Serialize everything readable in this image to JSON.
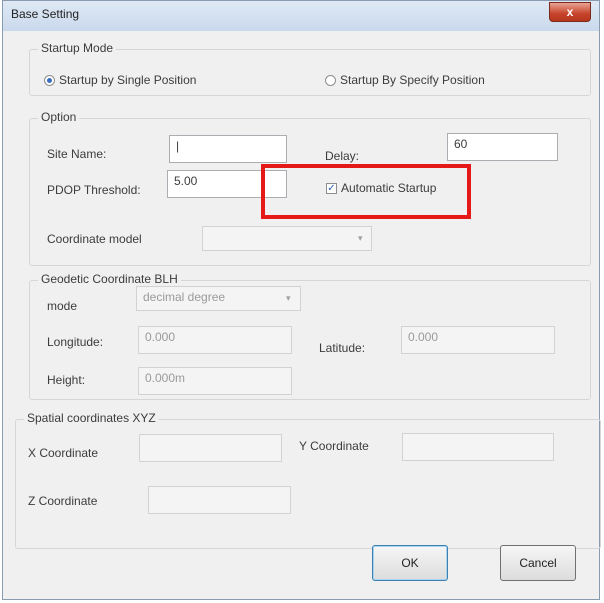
{
  "window": {
    "title": "Base Setting",
    "close_label": "x"
  },
  "startup_mode": {
    "legend": "Startup Mode",
    "option_single": "Startup by Single Position",
    "option_specify": "Startup By Specify Position",
    "selected": "single"
  },
  "option": {
    "legend": "Option",
    "site_name_label": "Site Name:",
    "site_name_value": "|",
    "delay_label": "Delay:",
    "delay_value": "60",
    "pdop_label": "PDOP Threshold:",
    "pdop_value": "5.00",
    "automatic_startup_label": "Automatic Startup",
    "automatic_startup_checked": true,
    "coordinate_model_label": "Coordinate model",
    "coordinate_model_value": ""
  },
  "geodetic": {
    "legend": "Geodetic Coordinate BLH",
    "mode_label": "mode",
    "mode_value": "decimal degree",
    "longitude_label": "Longitude:",
    "longitude_value": "0.000",
    "latitude_label": "Latitude:",
    "latitude_value": "0.000",
    "height_label": "Height:",
    "height_value": "0.000m"
  },
  "spatial": {
    "legend": "Spatial coordinates XYZ",
    "x_label": "X Coordinate",
    "x_value": "",
    "y_label": "Y Coordinate",
    "y_value": "",
    "z_label": "Z Coordinate",
    "z_value": ""
  },
  "buttons": {
    "ok": "OK",
    "cancel": "Cancel"
  },
  "colors": {
    "highlight": "#e61919",
    "accent": "#3a6fc0"
  }
}
